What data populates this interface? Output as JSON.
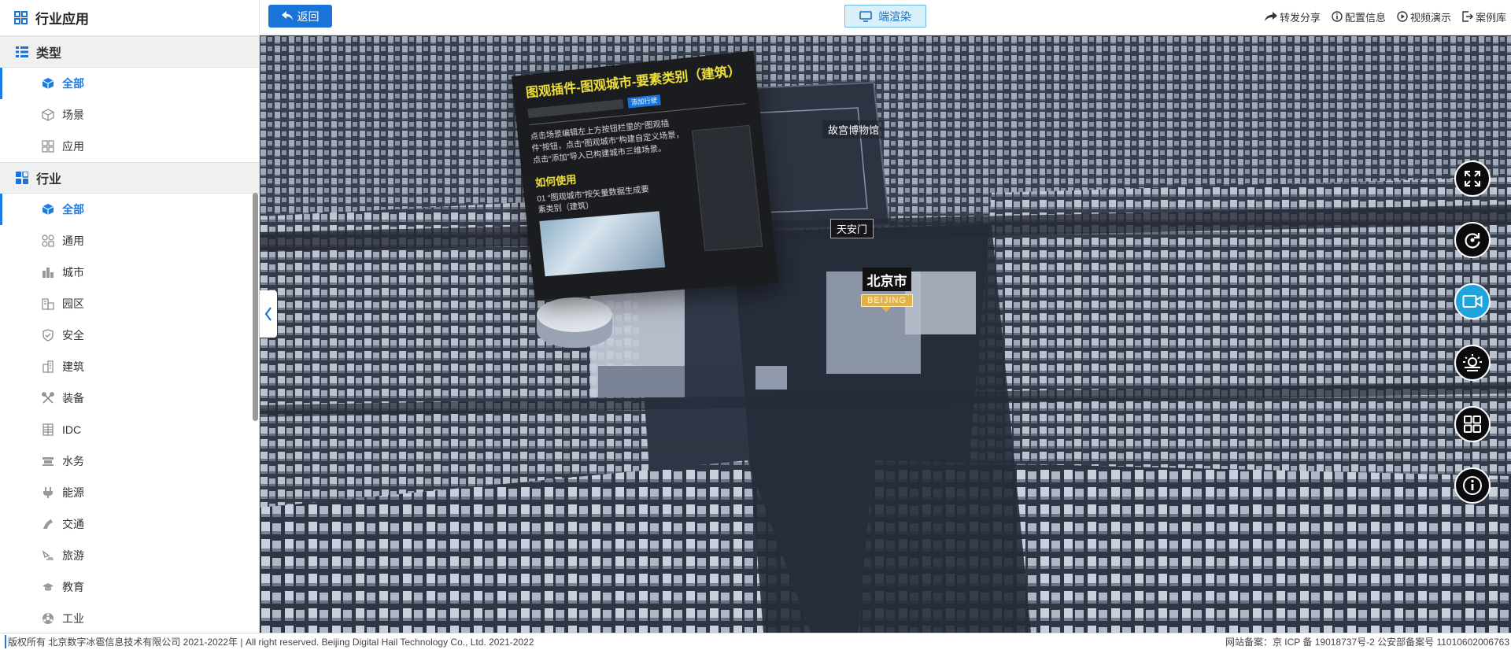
{
  "sidebar": {
    "title": "行业应用",
    "sections": [
      {
        "label": "类型",
        "items": [
          {
            "label": "全部",
            "icon": "cube-icon",
            "active": true
          },
          {
            "label": "场景",
            "icon": "cube-outline-icon"
          },
          {
            "label": "应用",
            "icon": "grid-apps-icon"
          }
        ]
      },
      {
        "label": "行业",
        "items": [
          {
            "label": "全部",
            "icon": "cube-icon",
            "active": true
          },
          {
            "label": "通用",
            "icon": "grid-icon"
          },
          {
            "label": "城市",
            "icon": "city-icon"
          },
          {
            "label": "园区",
            "icon": "park-icon"
          },
          {
            "label": "安全",
            "icon": "shield-icon"
          },
          {
            "label": "建筑",
            "icon": "building-icon"
          },
          {
            "label": "装备",
            "icon": "tools-icon"
          },
          {
            "label": "IDC",
            "icon": "server-icon"
          },
          {
            "label": "水务",
            "icon": "water-icon"
          },
          {
            "label": "能源",
            "icon": "plug-icon"
          },
          {
            "label": "交通",
            "icon": "traffic-icon"
          },
          {
            "label": "旅游",
            "icon": "travel-icon"
          },
          {
            "label": "教育",
            "icon": "graduation-cap-icon"
          },
          {
            "label": "工业",
            "icon": "industry-icon"
          }
        ]
      }
    ]
  },
  "topbar": {
    "back_label": "返回",
    "render_label": "端渲染",
    "links": [
      {
        "label": "转发分享",
        "icon": "share-icon"
      },
      {
        "label": "配置信息",
        "icon": "info-icon"
      },
      {
        "label": "视频演示",
        "icon": "play-icon"
      },
      {
        "label": "案例库",
        "icon": "exit-icon"
      }
    ]
  },
  "scene": {
    "panel_title": "图观插件-图观城市-要素类别（建筑）",
    "panel_badge": "添加行驶",
    "panel_text": "点击场景编辑左上方按钮栏里的“图观插件”按钮，点击“图观城市”构建自定义场景，点击“添加”导入已构建城市三维场景。",
    "panel_subtitle": "如何使用",
    "panel_step": "01 “图观城市”按矢量数据生成要素类别（建筑）",
    "labels": {
      "palace_museum": "故宫博物馆",
      "tiananmen": "天安门",
      "city_cn": "北京市",
      "city_en": "BEIJING"
    }
  },
  "tools": [
    {
      "name": "fullscreen-tool",
      "icon": "fullscreen-icon"
    },
    {
      "name": "rotate-tool",
      "icon": "rotate-icon"
    },
    {
      "name": "camera-tool",
      "icon": "video-camera-icon",
      "active": true
    },
    {
      "name": "weather-tool",
      "icon": "weather-icon"
    },
    {
      "name": "layers-tool",
      "icon": "grid-icon"
    },
    {
      "name": "info-tool",
      "icon": "info-icon"
    }
  ],
  "footer": {
    "left": "版权所有 北京数字冰雹信息技术有限公司 2021-2022年 | All right reserved. Beijing Digital Hail Technology Co., Ltd. 2021-2022",
    "right": "网站备案：京 ICP 备 19018737号-2 公安部备案号 11010602006763"
  },
  "colors": {
    "accent": "#1a7ce0",
    "back_button": "#1a74d8",
    "render_button_bg": "#d9f0fb",
    "active_tool": "#1fa3dd",
    "panel_title": "#f2e33a"
  }
}
